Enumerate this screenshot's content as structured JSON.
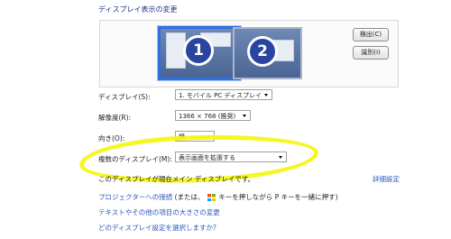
{
  "heading": "ディスプレイ表示の変更",
  "monitors": [
    {
      "number": "1",
      "selected": true
    },
    {
      "number": "2",
      "selected": false
    }
  ],
  "buttons": {
    "detect": "検出(C)",
    "identify": "識別(I)"
  },
  "settings": {
    "display_label": "ディスプレイ(S):",
    "display_value": "1. モバイル PC ディスプレイ",
    "resolution_label": "解像度(R):",
    "resolution_value": "1366 × 768 (推奨)",
    "orientation_label": "向き(O):",
    "orientation_value": "横",
    "multiple_label": "複数のディスプレイ(M):",
    "multiple_value": "表示画面を拡張する"
  },
  "status_text": "このディスプレイが現在メイン ディスプレイです。",
  "advanced_link": "詳細設定",
  "links": {
    "projector_link": "プロジェクターへの接続",
    "projector_rest": "(または、",
    "projector_rest2": "キーを押しながら P キーを一緒に押す)",
    "text_size": "テキストやその他の項目の大きさの変更",
    "which_settings": "どのディスプレイ設定を選択しますか?"
  },
  "colors": {
    "heading": "#1e3287",
    "link": "#2a58b8",
    "selected_border": "#2f6fe0",
    "highlight": "#f5f516"
  }
}
